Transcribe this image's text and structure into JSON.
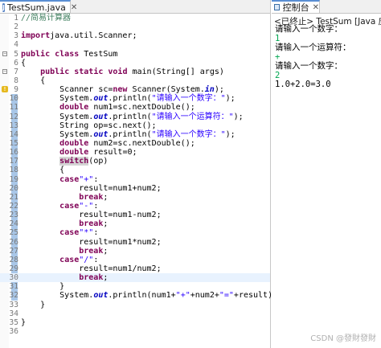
{
  "editor": {
    "tab_label": "TestSum.java",
    "tab_close": "✕",
    "current_line": 30,
    "lines": [
      {
        "n": "1",
        "segs": [
          [
            "cm",
            "//简易计算器"
          ]
        ]
      },
      {
        "n": "2",
        "segs": []
      },
      {
        "n": "3",
        "segs": [
          [
            "kw",
            "import"
          ],
          [
            "",
            "java.util.Scanner;"
          ]
        ]
      },
      {
        "n": "4",
        "segs": []
      },
      {
        "n": "5",
        "segs": [
          [
            "kw",
            "public class"
          ],
          [
            "",
            " TestSum"
          ]
        ]
      },
      {
        "n": "6",
        "segs": [
          [
            "",
            "{"
          ]
        ]
      },
      {
        "n": "7",
        "segs": [
          [
            "",
            "    "
          ],
          [
            "kw",
            "public static void"
          ],
          [
            "",
            " main(String[] args)"
          ]
        ]
      },
      {
        "n": "8",
        "segs": [
          [
            "",
            "    {"
          ]
        ]
      },
      {
        "n": "9",
        "segs": [
          [
            "",
            "        Scanner sc="
          ],
          [
            "kw",
            "new"
          ],
          [
            "",
            " Scanner(System."
          ],
          [
            "fi",
            "in"
          ],
          [
            "",
            ");"
          ]
        ]
      },
      {
        "n": "10",
        "segs": [
          [
            "",
            "        System."
          ],
          [
            "fi",
            "out"
          ],
          [
            "",
            ".println("
          ],
          [
            "st",
            "\"请输入一个数字：\""
          ],
          [
            "",
            ");"
          ]
        ]
      },
      {
        "n": "11",
        "segs": [
          [
            "",
            "        "
          ],
          [
            "kw",
            "double"
          ],
          [
            "",
            " num1=sc.nextDouble();"
          ]
        ]
      },
      {
        "n": "12",
        "segs": [
          [
            "",
            "        System."
          ],
          [
            "fi",
            "out"
          ],
          [
            "",
            ".println("
          ],
          [
            "st",
            "\"请输入一个运算符：\""
          ],
          [
            "",
            ");"
          ]
        ]
      },
      {
        "n": "13",
        "segs": [
          [
            "",
            "        String op=sc.next();"
          ]
        ]
      },
      {
        "n": "14",
        "segs": [
          [
            "",
            "        System."
          ],
          [
            "fi",
            "out"
          ],
          [
            "",
            ".println("
          ],
          [
            "st",
            "\"请输入一个数字：\""
          ],
          [
            "",
            ");"
          ]
        ]
      },
      {
        "n": "15",
        "segs": [
          [
            "",
            "        "
          ],
          [
            "kw",
            "double"
          ],
          [
            "",
            " num2=sc.nextDouble();"
          ]
        ]
      },
      {
        "n": "16",
        "segs": [
          [
            "",
            "        "
          ],
          [
            "kw",
            "double"
          ],
          [
            "",
            " result=0;"
          ]
        ]
      },
      {
        "n": "17",
        "segs": [
          [
            "",
            "        "
          ],
          [
            "kw hl",
            "switch"
          ],
          [
            "",
            "(op)"
          ]
        ]
      },
      {
        "n": "18",
        "segs": [
          [
            "",
            "        {"
          ]
        ]
      },
      {
        "n": "19",
        "segs": [
          [
            "",
            "        "
          ],
          [
            "kw",
            "case"
          ],
          [
            "st",
            "\"+\""
          ],
          [
            "",
            ":"
          ]
        ]
      },
      {
        "n": "20",
        "segs": [
          [
            "",
            "            result=num1+num2;"
          ]
        ]
      },
      {
        "n": "21",
        "segs": [
          [
            "",
            "            "
          ],
          [
            "kw",
            "break"
          ],
          [
            "",
            ";"
          ]
        ]
      },
      {
        "n": "22",
        "segs": [
          [
            "",
            "        "
          ],
          [
            "kw",
            "case"
          ],
          [
            "st",
            "\"-\""
          ],
          [
            "",
            ":"
          ]
        ]
      },
      {
        "n": "23",
        "segs": [
          [
            "",
            "            result=num1-num2;"
          ]
        ]
      },
      {
        "n": "24",
        "segs": [
          [
            "",
            "            "
          ],
          [
            "kw",
            "break"
          ],
          [
            "",
            ";"
          ]
        ]
      },
      {
        "n": "25",
        "segs": [
          [
            "",
            "        "
          ],
          [
            "kw",
            "case"
          ],
          [
            "st",
            "\"*\""
          ],
          [
            "",
            ":"
          ]
        ]
      },
      {
        "n": "26",
        "segs": [
          [
            "",
            "            result=num1*num2;"
          ]
        ]
      },
      {
        "n": "27",
        "segs": [
          [
            "",
            "            "
          ],
          [
            "kw",
            "break"
          ],
          [
            "",
            ";"
          ]
        ]
      },
      {
        "n": "28",
        "segs": [
          [
            "",
            "        "
          ],
          [
            "kw",
            "case"
          ],
          [
            "st",
            "\"/\""
          ],
          [
            "",
            ":"
          ]
        ]
      },
      {
        "n": "29",
        "segs": [
          [
            "",
            "            result=num1/num2;"
          ]
        ]
      },
      {
        "n": "30",
        "segs": [
          [
            "",
            "            "
          ],
          [
            "kw",
            "break"
          ],
          [
            "",
            ";"
          ]
        ]
      },
      {
        "n": "31",
        "segs": [
          [
            "",
            "        }"
          ]
        ]
      },
      {
        "n": "32",
        "segs": [
          [
            "",
            "        System."
          ],
          [
            "fi",
            "out"
          ],
          [
            "",
            ".println(num1+"
          ],
          [
            "st",
            "\"+\""
          ],
          [
            "",
            "+num2+"
          ],
          [
            "st",
            "\"=\""
          ],
          [
            "",
            "+result);"
          ]
        ]
      },
      {
        "n": "33",
        "segs": [
          [
            "",
            "    }"
          ]
        ]
      },
      {
        "n": "34",
        "segs": []
      },
      {
        "n": "35",
        "segs": [
          [
            "",
            "}"
          ]
        ]
      },
      {
        "n": "36",
        "segs": []
      }
    ]
  },
  "console": {
    "tab_label": "控制台",
    "tab_close": "✕",
    "header": "<已终止> TestSum [Java 应用程序",
    "lines": [
      {
        "kind": "out",
        "text": "请输入一个数字："
      },
      {
        "kind": "in",
        "text": "1"
      },
      {
        "kind": "out",
        "text": "请输入一个运算符："
      },
      {
        "kind": "in",
        "text": "+"
      },
      {
        "kind": "out",
        "text": "请输入一个数字："
      },
      {
        "kind": "in",
        "text": "2"
      },
      {
        "kind": "out",
        "text": "1.0+2.0=3.0"
      }
    ]
  },
  "watermark": "CSDN @發財發財"
}
